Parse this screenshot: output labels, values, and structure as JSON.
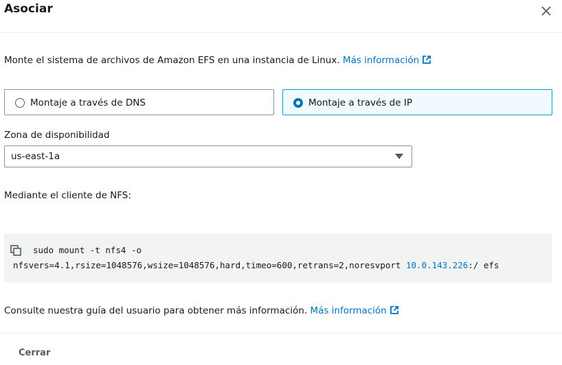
{
  "modal": {
    "title": "Asociar",
    "description": "Monte el sistema de archivos de Amazon EFS en una instancia de Linux.",
    "learn_more": "Más información"
  },
  "mount_options": [
    {
      "label": "Montaje a través de DNS",
      "selected": false
    },
    {
      "label": "Montaje a través de IP",
      "selected": true
    }
  ],
  "availability_zone": {
    "label": "Zona de disponibilidad",
    "value": "us-east-1a"
  },
  "nfs": {
    "label": "Mediante el cliente de NFS:",
    "command_line1": "sudo mount -t nfs4 -o",
    "command_line2_prefix": "nfsvers=4.1,rsize=1048576,wsize=1048576,hard,timeo=600,retrans=2,noresvport ",
    "ip": "10.0.143.226",
    "command_line2_suffix": ":/ efs"
  },
  "guide": {
    "text": "Consulte nuestra guía del usuario para obtener más información.",
    "learn_more": "Más información"
  },
  "footer": {
    "close_label": "Cerrar"
  },
  "colors": {
    "link": "#0073bb",
    "selected_border": "#00a1c9",
    "selected_bg": "#f1faff",
    "code_bg": "#f2f3f3"
  },
  "icons": [
    "close-icon",
    "external-link-icon",
    "copy-icon",
    "caret-down-icon"
  ]
}
